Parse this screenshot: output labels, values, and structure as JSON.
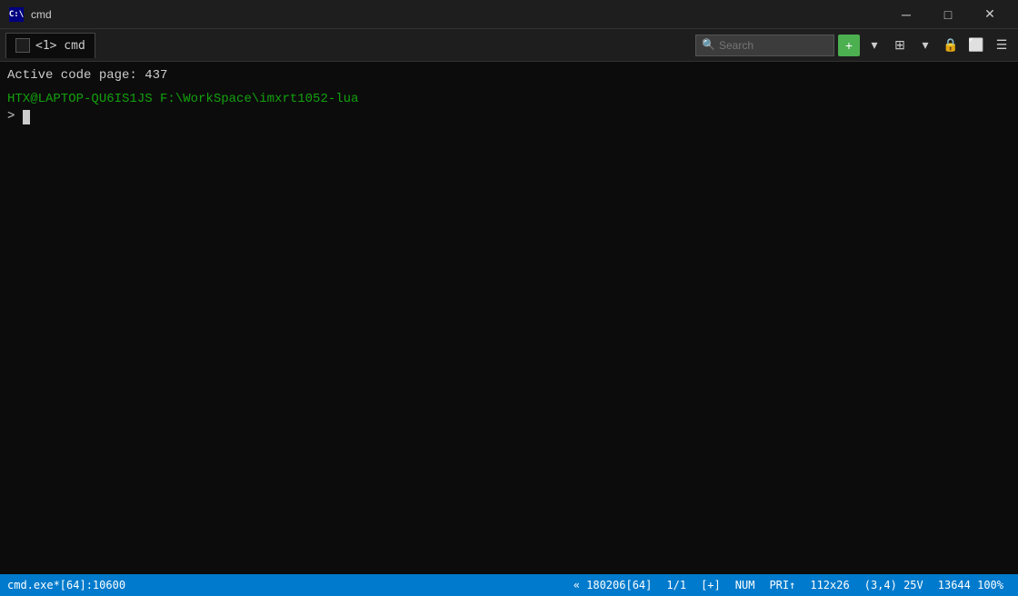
{
  "window": {
    "title": "cmd",
    "icon_label": "cmd-icon"
  },
  "title_bar": {
    "minimize_label": "─",
    "maximize_label": "□",
    "close_label": "✕"
  },
  "toolbar": {
    "tab_label": " <1> cmd",
    "search_placeholder": "Search",
    "search_value": "Search"
  },
  "terminal": {
    "line1": "Active code page: 437",
    "line2": "HTX@LAPTOP-QU6IS1JS F:\\WorkSpace\\imxrt1052-lua",
    "prompt_char": ">",
    "cursor_visible": true
  },
  "status_bar": {
    "item1": "cmd.exe*[64]:10600",
    "item2": "« 180206[64]",
    "item3": "1/1",
    "item4": "[+]",
    "item5": "NUM",
    "item6": "PRI↑",
    "item7": "112x26",
    "item8": "(3,4) 25V",
    "item9": "13644 100%"
  },
  "colors": {
    "terminal_bg": "#0c0c0c",
    "toolbar_bg": "#1e1e1e",
    "title_bg": "#1e1e1e",
    "status_bg": "#007acc",
    "prompt_color": "#13a10e",
    "text_color": "#cccccc",
    "accent_green": "#4caf50"
  }
}
